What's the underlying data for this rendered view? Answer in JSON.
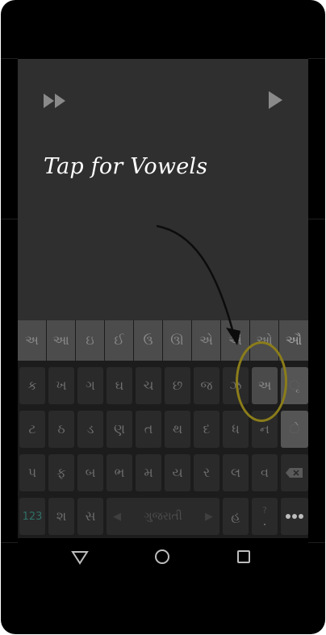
{
  "tutorial": {
    "title": "Tap for Vowels"
  },
  "keyboard": {
    "vowel_row": [
      "અ",
      "આ",
      "ઇ",
      "ઈ",
      "ઉ",
      "ઊ",
      "એ",
      "ઐ",
      "ઓ",
      "ઔ"
    ],
    "row1": [
      "ક",
      "ખ",
      "ગ",
      "ઘ",
      "ચ",
      "છ",
      "જ",
      "ઝ",
      "અ",
      "ૃ"
    ],
    "row2": [
      "ટ",
      "ઠ",
      "ડ",
      "ણ",
      "ત",
      "થ",
      "દ",
      "ધ",
      "ન",
      "ે"
    ],
    "row3": [
      "પ",
      "ફ",
      "બ",
      "ભ",
      "મ",
      "ય",
      "ર",
      "લ",
      "વ"
    ],
    "row4": {
      "numbers_label": "123",
      "key_sha": "શ",
      "key_sa": "સ",
      "space_label": "ગુજરાતી",
      "key_ha": "હ",
      "key_period": ".",
      "key_question": "?"
    },
    "icons": [
      "backspace-icon",
      "more-icon"
    ]
  },
  "nav": {
    "icons": [
      "back-icon",
      "home-icon",
      "recents-icon"
    ]
  },
  "colors": {
    "tutorial_bg": "#2f2f2f",
    "highlight_ring": "#8b7d1a",
    "keyboard_bg": "#1c1c1c"
  }
}
